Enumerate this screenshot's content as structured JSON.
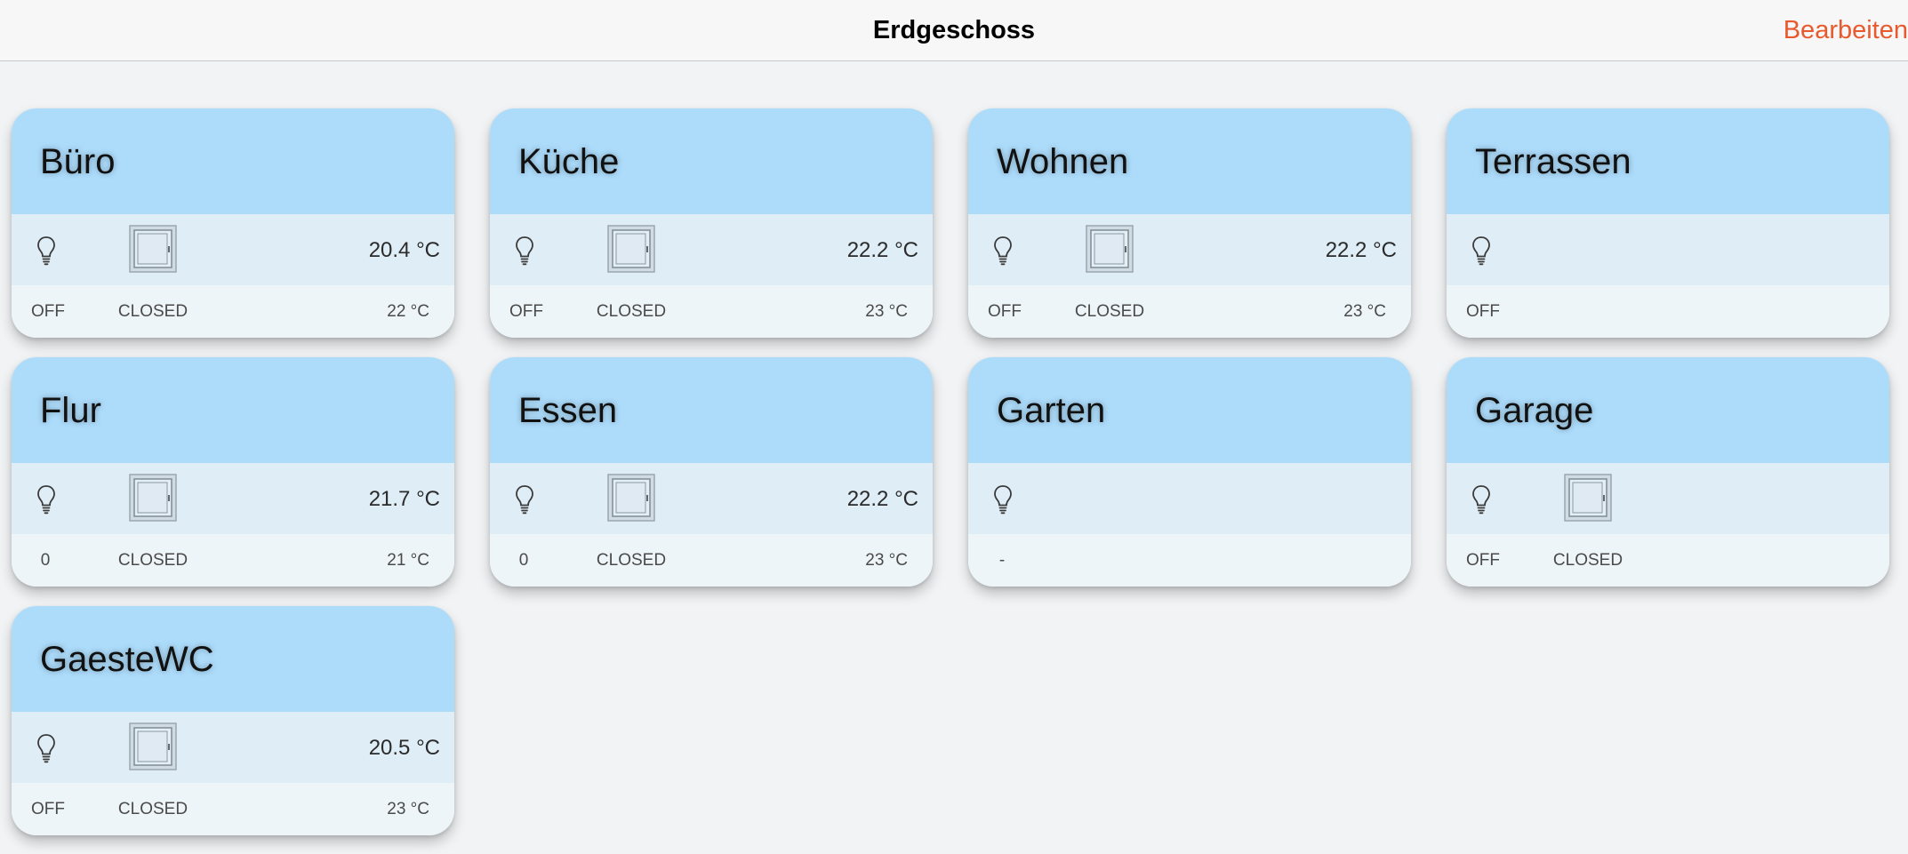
{
  "header": {
    "title": "Erdgeschoss",
    "edit_label": "Bearbeiten"
  },
  "colors": {
    "accent": "#e8592e",
    "card_header": "#addcfb",
    "card_middle": "#dfedf6",
    "card_footer": "#eef5f9",
    "background": "#f1f3f5"
  },
  "rooms": [
    {
      "name": "Büro",
      "has_window": true,
      "temperature": "20.4 °C",
      "light_state": "OFF",
      "window_state": "CLOSED",
      "setpoint": "22 °C"
    },
    {
      "name": "Küche",
      "has_window": true,
      "temperature": "22.2 °C",
      "light_state": "OFF",
      "window_state": "CLOSED",
      "setpoint": "23 °C"
    },
    {
      "name": "Wohnen",
      "has_window": true,
      "temperature": "22.2 °C",
      "light_state": "OFF",
      "window_state": "CLOSED",
      "setpoint": "23 °C"
    },
    {
      "name": "Terrassen",
      "has_window": false,
      "temperature": "",
      "light_state": "OFF",
      "window_state": "",
      "setpoint": ""
    },
    {
      "name": "Flur",
      "has_window": true,
      "temperature": "21.7 °C",
      "light_state": "0",
      "window_state": "CLOSED",
      "setpoint": "21 °C"
    },
    {
      "name": "Essen",
      "has_window": true,
      "temperature": "22.2 °C",
      "light_state": "0",
      "window_state": "CLOSED",
      "setpoint": "23 °C"
    },
    {
      "name": "Garten",
      "has_window": false,
      "temperature": "",
      "light_state": "-",
      "window_state": "",
      "setpoint": ""
    },
    {
      "name": "Garage",
      "has_window": true,
      "temperature": "",
      "light_state": "OFF",
      "window_state": "CLOSED",
      "setpoint": ""
    },
    {
      "name": "GaesteWC",
      "has_window": true,
      "temperature": "20.5 °C",
      "light_state": "OFF",
      "window_state": "CLOSED",
      "setpoint": "23 °C"
    }
  ],
  "icons": {
    "light": "lightbulb-icon",
    "window": "window-icon"
  }
}
